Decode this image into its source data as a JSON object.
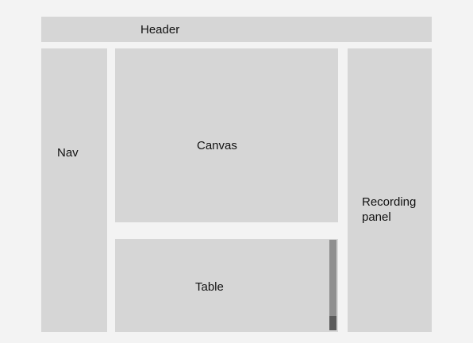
{
  "header": {
    "label": "Header"
  },
  "nav": {
    "label": "Nav"
  },
  "canvas": {
    "label": "Canvas"
  },
  "table": {
    "label": "Table"
  },
  "recording_panel": {
    "label": "Recording panel"
  },
  "colors": {
    "background": "#f3f3f3",
    "block": "#d6d6d6",
    "scrollbar_track": "#8f8f8f",
    "scrollbar_thumb": "#5b5b5b",
    "text": "#111111"
  }
}
